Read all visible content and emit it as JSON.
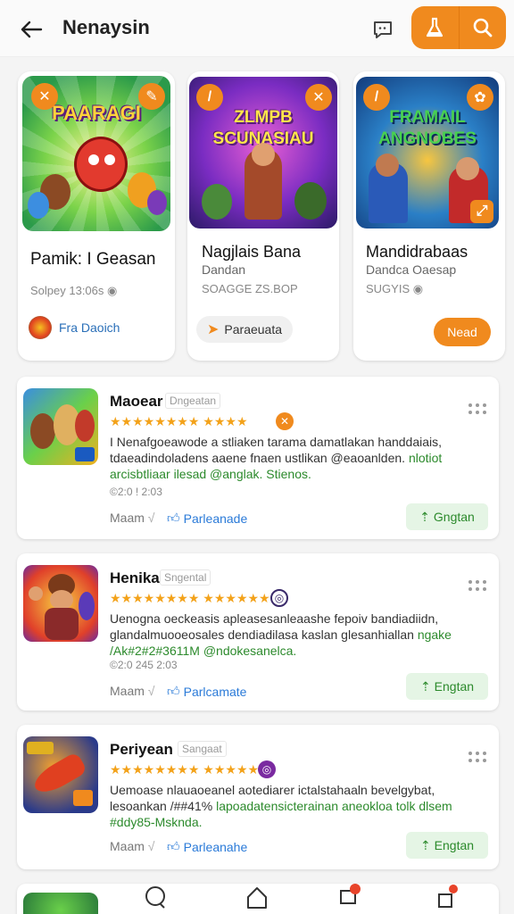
{
  "header": {
    "title": "Nenaysin"
  },
  "featured": [
    {
      "art_title": "PAARAGI",
      "title": "Pamik: I Geasan",
      "subtitle": "",
      "meta": "Solpey 13:06s",
      "button": "Fra Daoich"
    },
    {
      "art_title": "ZLMPB SCUNASIAU",
      "title": "Nagjlais Bana",
      "subtitle": "Dandan",
      "meta": "SOAGGE ZS.BOP",
      "button": "Paraeuata"
    },
    {
      "art_title": "FRAMAIL ANGNOBES",
      "title": "Mandidrabaas",
      "subtitle": "Dandca Oaesap",
      "meta": "SUGYIS",
      "button": "Nead"
    }
  ],
  "list": [
    {
      "name": "Maoear",
      "tag": "Dngeatan",
      "stars": "★★★★★★★★ ★★★★",
      "desc_1": "I Nenafgoeawode a stliaken tarama damatlakan handdaiais, tdaeadindoladens aaene fnaen ustlikan @eaoanlden.",
      "desc_hl": "nlotiot arcisbtliaar ilesad @anglak. Stienos.",
      "date": "©2:0 ! 2:03",
      "foot_left": "Maam",
      "link": "Parleanade",
      "button": "Gngtan"
    },
    {
      "name": "Henika",
      "tag": "Sngental",
      "stars": "★★★★★★★★ ★★★★★★",
      "desc_1": "Uenogna oeckeasis apleasesanleaashe fepoiv bandiadiidn, glandalmuooeosales dendiadilasa kaslan glesanhiallan",
      "desc_hl": "ngake /Ak#2#2#3611M @ndokesanelca.",
      "date": "©2:0 245 2:03",
      "foot_left": "Maam",
      "link": "Parlcamate",
      "button": "Engtan"
    },
    {
      "name": "Periyean",
      "tag": "Sangaat",
      "stars": "★★★★★★★★ ★★★★★★",
      "desc_1": "Uemoase nlauaoeanel aotediarer ictalstahaaln bevelgybat, lesoankan /##41%",
      "desc_hl": "lapoadatensicterainan aneokloa tolk dlsem #ddy85-Msknda.",
      "date": "",
      "foot_left": "Maam",
      "link": "Parleanahe",
      "button": "Engtan"
    }
  ],
  "colors": {
    "accent": "#f08a1e",
    "green": "#2c8a2c",
    "link": "#2a7ad8"
  }
}
